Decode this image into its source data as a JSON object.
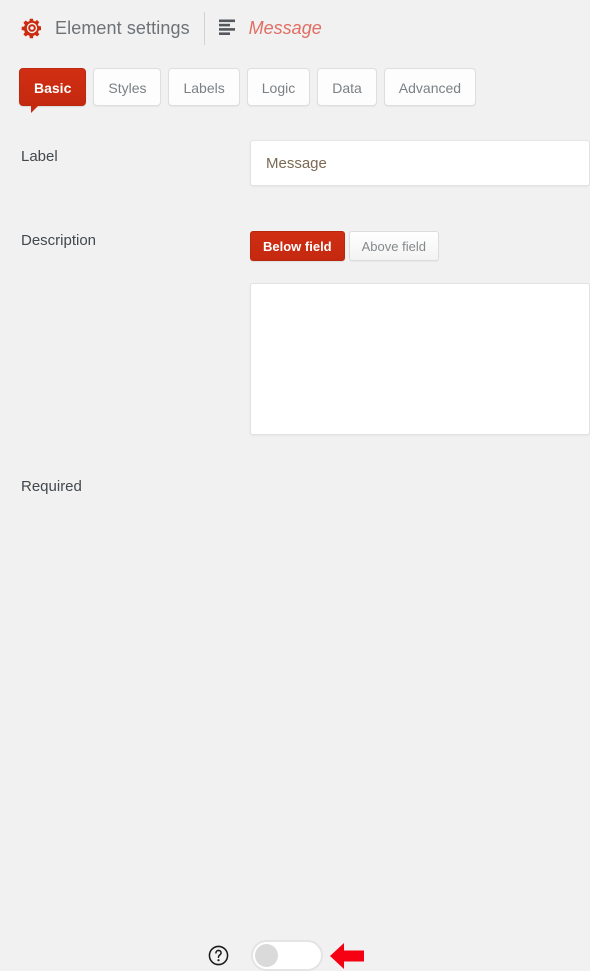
{
  "header": {
    "gear_icon": "gear-icon",
    "title": "Element settings",
    "divider": "vertical-separator",
    "element_icon": "text-align-icon",
    "element_name": "Message",
    "accent_color": "#cc2b10",
    "element_name_color": "#e06e63",
    "title_color": "#6d7276"
  },
  "tabs": {
    "active": "Basic",
    "items": [
      {
        "label": "Basic",
        "active": true
      },
      {
        "label": "Styles",
        "active": false
      },
      {
        "label": "Labels",
        "active": false
      },
      {
        "label": "Logic",
        "active": false
      },
      {
        "label": "Data",
        "active": false
      },
      {
        "label": "Advanced",
        "active": false
      }
    ]
  },
  "fields": {
    "label": {
      "name": "Label",
      "value": "Message",
      "placeholder": ""
    },
    "description": {
      "name": "Description",
      "position_options": [
        {
          "label": "Below field",
          "active": true
        },
        {
          "label": "Above field",
          "active": false
        }
      ],
      "value": "",
      "placeholder": ""
    },
    "required": {
      "name": "Required",
      "help_icon": "question-mark-circle-icon",
      "toggle_state": "off",
      "toggle_aria": "Required toggle, off"
    }
  },
  "annotation": {
    "arrow": "red-left-pointing-arrow",
    "arrow_color": "#f60014",
    "points_at": "required-toggle"
  },
  "colors": {
    "page_background": "#f1f1f1",
    "panel_white": "#ffffff",
    "border_grey": "#e2e2e2",
    "text_dark": "#43484c",
    "text_muted": "#7b8084"
  }
}
